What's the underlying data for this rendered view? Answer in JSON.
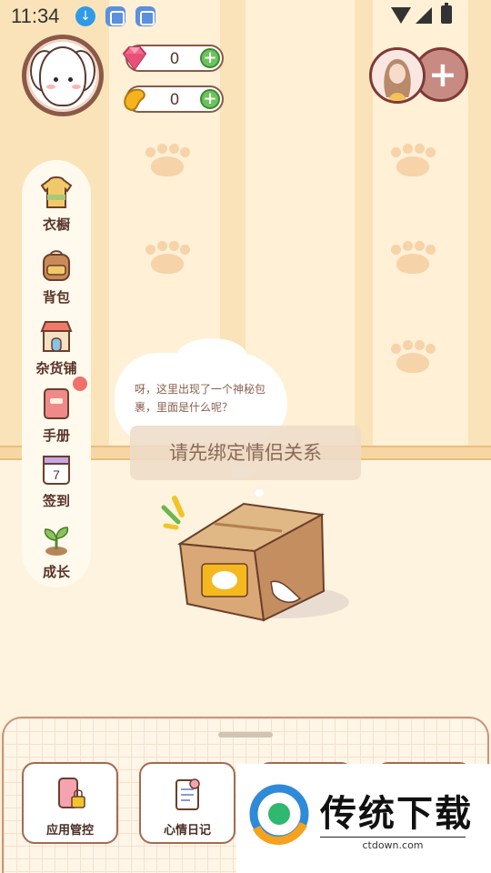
{
  "status_bar": {
    "time": "11:34",
    "icons": [
      "download-icon",
      "app-icon",
      "app-icon",
      "wifi-icon",
      "signal-icon",
      "battery-icon"
    ]
  },
  "profile": {
    "avatar_icon": "dog-avatar-icon"
  },
  "currencies": {
    "gems": {
      "icon": "gem-icon",
      "value": "0",
      "add_icon": "plus-icon"
    },
    "beans": {
      "icon": "bean-icon",
      "value": "0",
      "add_icon": "plus-icon"
    }
  },
  "partner": {
    "avatar_icon": "partner-avatar-icon",
    "add_icon": "plus-icon"
  },
  "side_menu": {
    "items": [
      {
        "label": "衣橱",
        "icon": "wardrobe-icon"
      },
      {
        "label": "背包",
        "icon": "backpack-icon"
      },
      {
        "label": "杂货铺",
        "icon": "shop-icon"
      },
      {
        "label": "手册",
        "icon": "handbook-icon"
      },
      {
        "label": "签到",
        "icon": "calendar-icon",
        "calendar_day": "7"
      },
      {
        "label": "成长",
        "icon": "sprout-icon"
      }
    ]
  },
  "bubble": {
    "text": "呀，这里出现了一个神秘包裹，里面是什么呢？"
  },
  "toast": {
    "text": "请先绑定情侣关系"
  },
  "bottom_panel": {
    "cards": [
      {
        "label": "应用管控",
        "icon": "phone-lock-icon"
      },
      {
        "label": "心情日记",
        "icon": "diary-icon"
      }
    ]
  },
  "watermark": {
    "brand": "传统下载",
    "url": "ctdown.com"
  },
  "colors": {
    "wall_stripe_dark": "#fbe3b9",
    "wall_stripe_light": "#fff0d6",
    "accent_brown": "#8a5948",
    "plus_green": "#6bc45b",
    "badge_red": "#f0706a"
  }
}
